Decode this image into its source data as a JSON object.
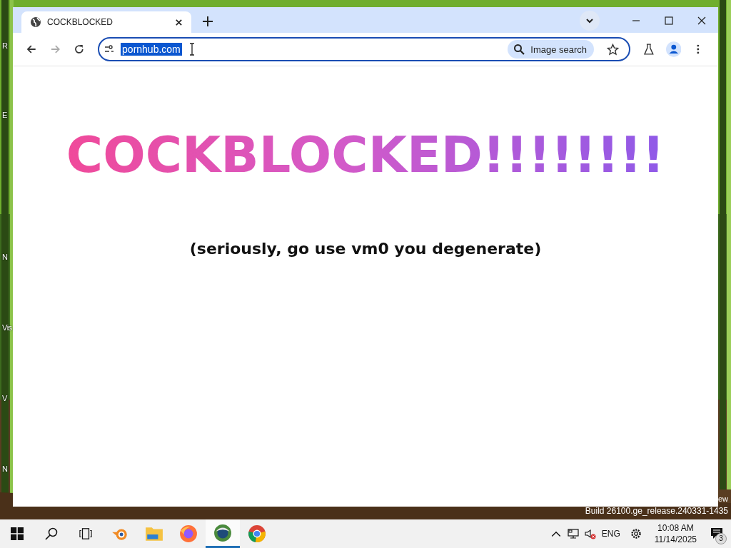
{
  "browser": {
    "tabs": [
      {
        "title": "COCKBLOCKED",
        "selected": true
      }
    ],
    "address": {
      "value": "pornhub.com",
      "text_selected": true
    },
    "image_search": "Image search"
  },
  "page": {
    "heading": "COCKBLOCKED!!!!!!!!",
    "subtitle": "(seriously, go use vm0 you degenerate)"
  },
  "desktop": {
    "icon_labels": [
      "R",
      "E",
      "N",
      "Vis",
      "V",
      "N"
    ],
    "watermark": [
      "ew",
      "Build 26100.ge_release.240331-1435"
    ]
  },
  "taskbar": {
    "apps": [
      {
        "kind": "blender",
        "active": false
      },
      {
        "kind": "folder",
        "active": false
      },
      {
        "kind": "firefox",
        "active": false
      },
      {
        "kind": "globe",
        "active": true
      },
      {
        "kind": "chrome",
        "active": false
      }
    ],
    "language": "ENG",
    "time": "10:08 AM",
    "date": "11/14/2025",
    "notifications": "3"
  }
}
